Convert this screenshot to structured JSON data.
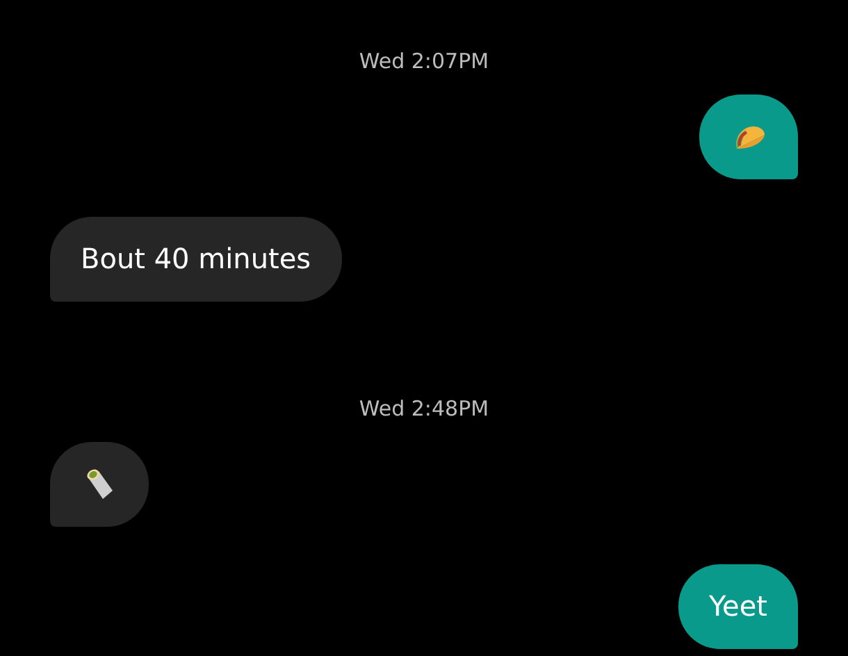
{
  "messages": [
    {
      "kind": "time",
      "text": "Wed 2:07PM"
    },
    {
      "kind": "taco",
      "outgoing": true
    },
    {
      "kind": "text",
      "outgoing": false,
      "text": "Bout 40 minutes"
    },
    {
      "kind": "time",
      "text": "Wed 2:48PM"
    },
    {
      "kind": "burrito",
      "outgoing": false
    },
    {
      "kind": "text",
      "outgoing": true,
      "text": "Yeet"
    }
  ]
}
